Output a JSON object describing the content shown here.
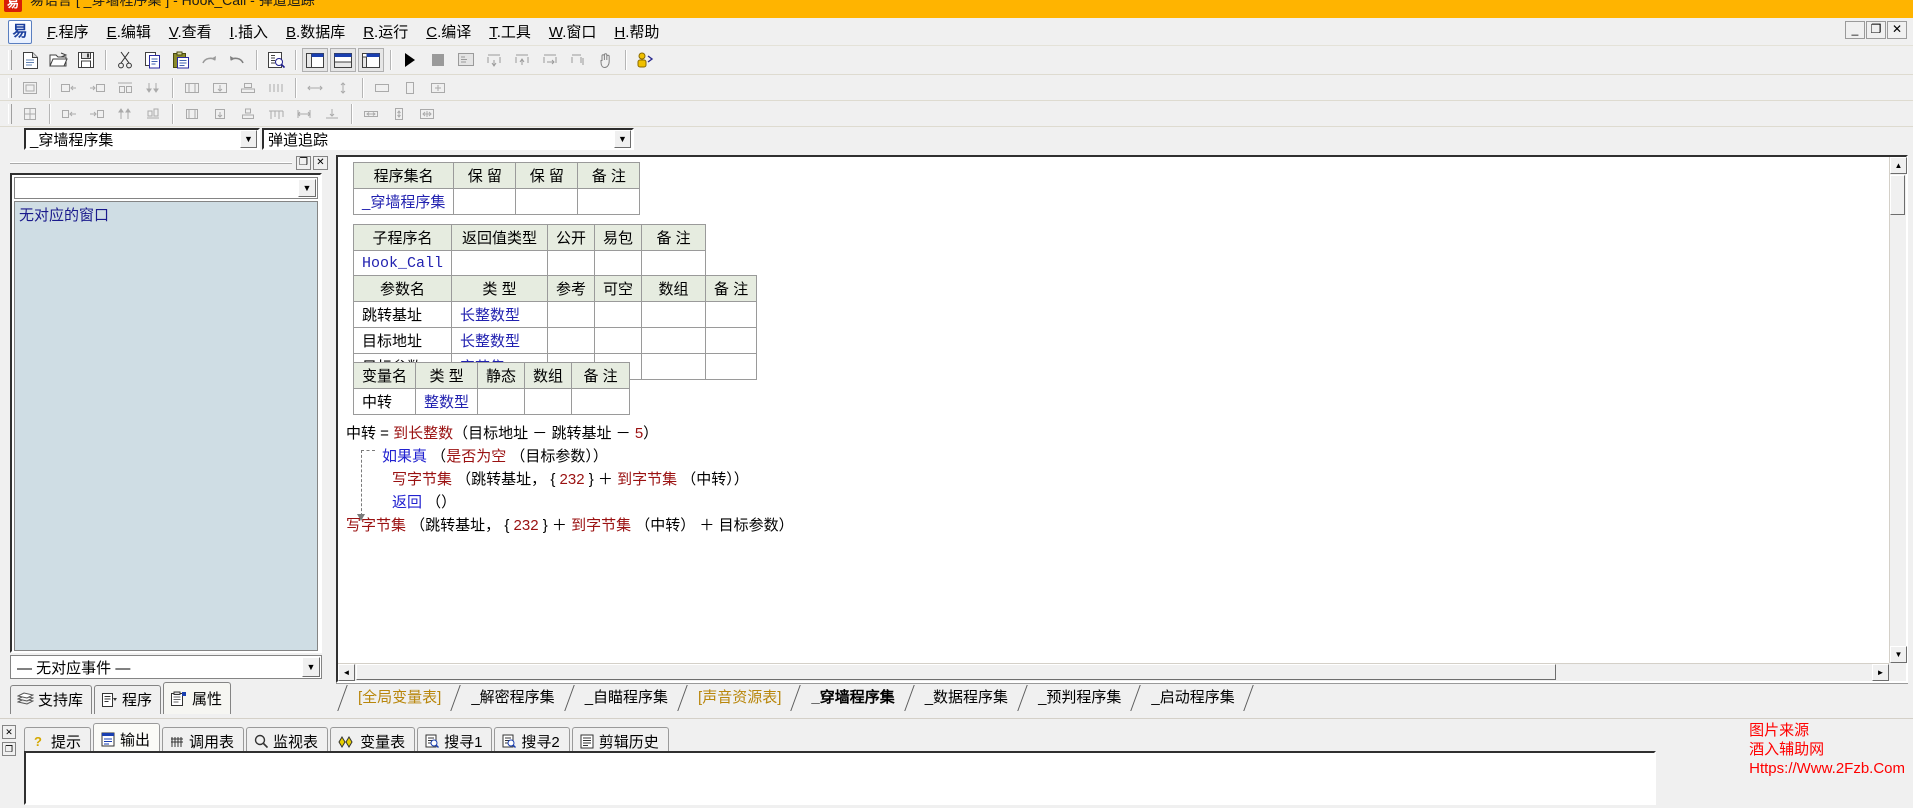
{
  "window": {
    "title": "易语言  [ _穿墙程序集 ]  -  Hook_Call  -  弹道追踪",
    "logo_text": "易",
    "minimize": "_",
    "restore": "❐",
    "close": "✕"
  },
  "menubar": {
    "app_icon": "易",
    "items": [
      {
        "accel": "F",
        "label": ".程序"
      },
      {
        "accel": "E",
        "label": ".编辑"
      },
      {
        "accel": "V",
        "label": ".查看"
      },
      {
        "accel": "I",
        "label": ".插入"
      },
      {
        "accel": "B",
        "label": ".数据库"
      },
      {
        "accel": "R",
        "label": ".运行"
      },
      {
        "accel": "C",
        "label": ".编译"
      },
      {
        "accel": "T",
        "label": ".工具"
      },
      {
        "accel": "W",
        "label": ".窗口"
      },
      {
        "accel": "H",
        "label": ".帮助"
      }
    ]
  },
  "toolbar1": {
    "buttons": [
      {
        "name": "new-file-icon",
        "tip": "新建"
      },
      {
        "name": "open-file-icon",
        "tip": "打开"
      },
      {
        "name": "save-file-icon",
        "tip": "保存"
      },
      {
        "name": "cut-icon",
        "tip": "剪切"
      },
      {
        "name": "copy-icon",
        "tip": "复制"
      },
      {
        "name": "paste-icon",
        "tip": "粘贴"
      },
      {
        "name": "redo-icon",
        "tip": "重做"
      },
      {
        "name": "undo-icon",
        "tip": "撤销"
      },
      {
        "name": "find-icon",
        "tip": "查找"
      },
      {
        "name": "layout-left-icon",
        "tip": "布局1"
      },
      {
        "name": "layout-top-icon",
        "tip": "布局2"
      },
      {
        "name": "layout-split-icon",
        "tip": "布局3"
      },
      {
        "name": "run-icon",
        "tip": "运行"
      },
      {
        "name": "stop-icon",
        "tip": "停止"
      },
      {
        "name": "debug-window-icon",
        "tip": "调试窗口"
      },
      {
        "name": "step-over-icon",
        "tip": "单步跳过"
      },
      {
        "name": "step-into-icon",
        "tip": "单步进入"
      },
      {
        "name": "step-out-icon",
        "tip": "单步跳出"
      },
      {
        "name": "run-to-cursor-icon",
        "tip": "运行到光标"
      },
      {
        "name": "breakpoint-hand-icon",
        "tip": "断点"
      },
      {
        "name": "support-library-icon",
        "tip": "支持库配置"
      }
    ]
  },
  "toolbar2": {
    "buttons": [
      {
        "name": "align-box-icon"
      },
      {
        "name": "align-left-in-icon"
      },
      {
        "name": "align-right-in-icon"
      },
      {
        "name": "align-center-icon"
      },
      {
        "name": "align-bottom-icon"
      },
      {
        "name": "group-left-icon"
      },
      {
        "name": "group-mid-icon"
      },
      {
        "name": "group-stack-icon"
      },
      {
        "name": "distribute-icon"
      },
      {
        "name": "space-h-icon"
      },
      {
        "name": "space-v-icon"
      },
      {
        "name": "size-width-icon"
      },
      {
        "name": "size-height-icon"
      },
      {
        "name": "size-both-icon"
      }
    ]
  },
  "toolbar3": {
    "buttons": [
      {
        "name": "grid-icon"
      },
      {
        "name": "align-left-edge-icon"
      },
      {
        "name": "align-right-edge-icon"
      },
      {
        "name": "align-top-edge-icon"
      },
      {
        "name": "align-bottom-edge-icon"
      },
      {
        "name": "center-h-icon"
      },
      {
        "name": "center-v-icon"
      },
      {
        "name": "stack-icon"
      },
      {
        "name": "column-icon"
      },
      {
        "name": "spread-h-icon"
      },
      {
        "name": "spread-v-icon"
      },
      {
        "name": "same-width-icon"
      },
      {
        "name": "same-height-icon"
      },
      {
        "name": "same-size-icon"
      }
    ]
  },
  "selectors": {
    "program_set": "_穿墙程序集",
    "sub_program": "弹道追踪",
    "arrow": "▼"
  },
  "dock": {
    "maximize_btn": "❐",
    "close_btn": "✕",
    "filter_value": "",
    "filter_arrow": "▼",
    "list_items": [
      "无对应的窗口"
    ],
    "event_value": "— 无对应事件 —",
    "event_arrow": "▼",
    "tabs": [
      {
        "label": "支持库",
        "icon": "books-icon",
        "active": false
      },
      {
        "label": "程序",
        "icon": "program-tree-icon",
        "active": false
      },
      {
        "label": "属性",
        "icon": "properties-icon",
        "active": true
      }
    ]
  },
  "editor": {
    "assembly_table": {
      "headers": [
        "程序集名",
        "保 留",
        "保 留",
        "备 注"
      ],
      "rows": [
        [
          "_穿墙程序集",
          "",
          "",
          ""
        ]
      ]
    },
    "sub_table": {
      "headers": [
        "子程序名",
        "返回值类型",
        "公开",
        "易包",
        "备 注"
      ],
      "rows": [
        [
          "Hook_Call",
          "",
          "",
          "",
          ""
        ]
      ]
    },
    "param_table": {
      "headers": [
        "参数名",
        "类 型",
        "参考",
        "可空",
        "数组",
        "备 注"
      ],
      "rows": [
        [
          "跳转基址",
          "长整数型",
          "",
          "",
          "",
          ""
        ],
        [
          "目标地址",
          "长整数型",
          "",
          "",
          "",
          ""
        ],
        [
          "目标参数",
          "字节集",
          "",
          "✔",
          "",
          ""
        ]
      ]
    },
    "var_table": {
      "headers": [
        "变量名",
        "类 型",
        "静态",
        "数组",
        "备 注"
      ],
      "rows": [
        [
          "中转",
          "整数型",
          "",
          "",
          ""
        ]
      ]
    },
    "code_lines": [
      {
        "indent": 0,
        "tokens": [
          {
            "t": "中转 ",
            "c": "pt"
          },
          {
            "t": "= ",
            "c": "pt"
          },
          {
            "t": "到长整数",
            "c": "fn"
          },
          {
            "t": "（目标地址 ",
            "c": "pt"
          },
          {
            "t": "－ ",
            "c": "pt"
          },
          {
            "t": "跳转基址 ",
            "c": "pt"
          },
          {
            "t": "－ ",
            "c": "pt"
          },
          {
            "t": "5",
            "c": "num"
          },
          {
            "t": "）",
            "c": "pt"
          }
        ]
      },
      {
        "indent": 1,
        "tokens": [
          {
            "t": "如果真 ",
            "c": "kw"
          },
          {
            "t": "（",
            "c": "pt"
          },
          {
            "t": "是否为空 ",
            "c": "fn"
          },
          {
            "t": "（目标参数））",
            "c": "pt"
          }
        ]
      },
      {
        "indent": 2,
        "tokens": [
          {
            "t": "写字节集 ",
            "c": "fn"
          },
          {
            "t": "（跳转基址， { ",
            "c": "pt"
          },
          {
            "t": "232",
            "c": "num"
          },
          {
            "t": " } ＋ ",
            "c": "pt"
          },
          {
            "t": "到字节集 ",
            "c": "fn"
          },
          {
            "t": "（中转））",
            "c": "pt"
          }
        ]
      },
      {
        "indent": 2,
        "tokens": [
          {
            "t": "返回 ",
            "c": "kw"
          },
          {
            "t": "（）",
            "c": "pt"
          }
        ]
      },
      {
        "indent": 0,
        "tokens": [
          {
            "t": "写字节集 ",
            "c": "fn"
          },
          {
            "t": "（跳转基址， { ",
            "c": "pt"
          },
          {
            "t": "232",
            "c": "num"
          },
          {
            "t": " } ＋ ",
            "c": "pt"
          },
          {
            "t": "到字节集 ",
            "c": "fn"
          },
          {
            "t": "（中转） ＋ ",
            "c": "pt"
          },
          {
            "t": "目标参数）",
            "c": "pt"
          }
        ]
      }
    ],
    "scroll_up": "▲",
    "scroll_down": "▼",
    "scroll_left": "◄",
    "scroll_right": "►"
  },
  "sheet_tabs": [
    {
      "label": "[全局变量表]",
      "style": "yellow",
      "active": false
    },
    {
      "label": "_解密程序集",
      "style": "normal",
      "active": false
    },
    {
      "label": "_自瞄程序集",
      "style": "normal",
      "active": false
    },
    {
      "label": "[声音资源表]",
      "style": "yellow",
      "active": false
    },
    {
      "label": "_穿墙程序集",
      "style": "normal",
      "active": true
    },
    {
      "label": "_数据程序集",
      "style": "normal",
      "active": false
    },
    {
      "label": "_预判程序集",
      "style": "normal",
      "active": false
    },
    {
      "label": "_启动程序集",
      "style": "normal",
      "active": false
    }
  ],
  "bottom_pane": {
    "close_btn": "✕",
    "restore_btn": "❐",
    "tabs": [
      {
        "label": "提示",
        "icon": "question-icon",
        "active": false
      },
      {
        "label": "输出",
        "icon": "output-icon",
        "active": true
      },
      {
        "label": "调用表",
        "icon": "calltable-icon",
        "active": false
      },
      {
        "label": "监视表",
        "icon": "magnifier-icon",
        "active": false
      },
      {
        "label": "变量表",
        "icon": "variables-icon",
        "active": false
      },
      {
        "label": "搜寻1",
        "icon": "search1-icon",
        "active": false
      },
      {
        "label": "搜寻2",
        "icon": "search2-icon",
        "active": false
      },
      {
        "label": "剪辑历史",
        "icon": "clipboard-history-icon",
        "active": false
      }
    ],
    "content": ""
  },
  "watermark": {
    "line1": "图片来源",
    "line2": "酒入辅助网",
    "line3": "Https://Www.2Fzb.Com"
  }
}
